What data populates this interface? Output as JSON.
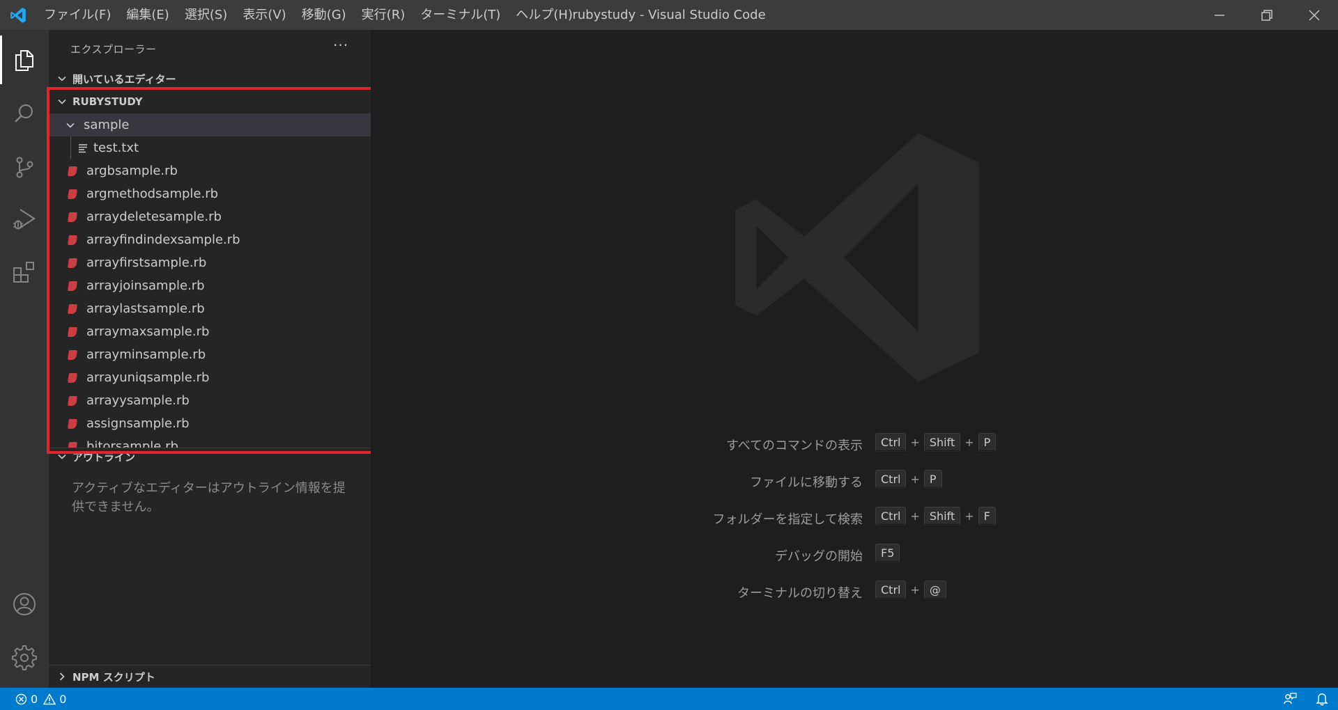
{
  "titlebar": {
    "menu": [
      "ファイル(F)",
      "編集(E)",
      "選択(S)",
      "表示(V)",
      "移動(G)",
      "実行(R)",
      "ターミナル(T)",
      "ヘルプ(H)"
    ],
    "window_title": "rubystudy - Visual Studio Code"
  },
  "activitybar": {
    "icons": [
      "explorer-icon",
      "search-icon",
      "source-control-icon",
      "run-debug-icon",
      "extensions-icon",
      "account-icon",
      "settings-gear-icon"
    ]
  },
  "sidebar": {
    "title": "エクスプローラー",
    "more_label": "···",
    "open_editors_label": "開いているエディター",
    "workspace_label": "RUBYSTUDY",
    "folder_label": "sample",
    "folder_child": "test.txt",
    "files": [
      "argbsample.rb",
      "argmethodsample.rb",
      "arraydeletesample.rb",
      "arrayfindindexsample.rb",
      "arrayfirstsample.rb",
      "arrayjoinsample.rb",
      "arraylastsample.rb",
      "arraymaxsample.rb",
      "arrayminsample.rb",
      "arrayuniqsample.rb",
      "arrayysample.rb",
      "assignsample.rb",
      "bitorsample.rb"
    ],
    "outline_label": "アウトライン",
    "outline_message": "アクティブなエディターはアウトライン情報を提供できません。",
    "npm_label": "NPM スクリプト"
  },
  "editor": {
    "shortcuts": [
      {
        "label": "すべてのコマンドの表示",
        "keys": [
          "Ctrl",
          "Shift",
          "P"
        ]
      },
      {
        "label": "ファイルに移動する",
        "keys": [
          "Ctrl",
          "P"
        ]
      },
      {
        "label": "フォルダーを指定して検索",
        "keys": [
          "Ctrl",
          "Shift",
          "F"
        ]
      },
      {
        "label": "デバッグの開始",
        "keys": [
          "F5"
        ]
      },
      {
        "label": "ターミナルの切り替え",
        "keys": [
          "Ctrl",
          "@"
        ]
      }
    ]
  },
  "statusbar": {
    "errors": "0",
    "warnings": "0"
  },
  "colors": {
    "accent": "#007acc",
    "highlight": "#e0252d",
    "ruby": "#cc3e44"
  }
}
